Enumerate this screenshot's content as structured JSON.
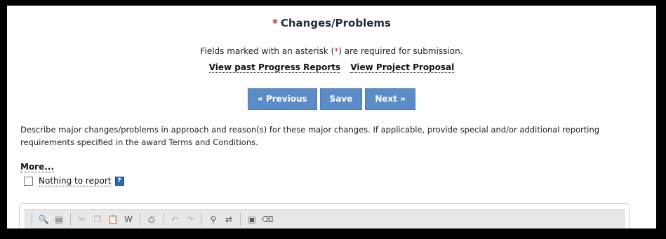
{
  "page": {
    "title_asterisk": "*",
    "title": "Changes/Problems",
    "required_note_before": "Fields marked with an asterisk (",
    "required_note_asterisk": "*",
    "required_note_after": ") are required for submission.",
    "link_past_reports": "View past Progress Reports",
    "link_proposal": "View Project Proposal"
  },
  "buttons": {
    "previous": "« Previous",
    "save": "Save",
    "next": "Next »"
  },
  "description": "Describe major changes/problems in approach and reason(s) for these major changes. If applicable, provide special and/or additional reporting requirements specified in the award Terms and Conditions.",
  "more_link": "More...",
  "nothing_to_report": {
    "label": "Nothing to report",
    "checked": false,
    "help_glyph": "?"
  },
  "toolbar_icons": [
    "preview-icon",
    "templates-icon",
    "cut-icon",
    "copy-icon",
    "paste-icon",
    "paste-word-icon",
    "print-icon",
    "undo-icon",
    "redo-icon",
    "find-icon",
    "replace-icon",
    "select-all-icon",
    "remove-format-icon"
  ]
}
